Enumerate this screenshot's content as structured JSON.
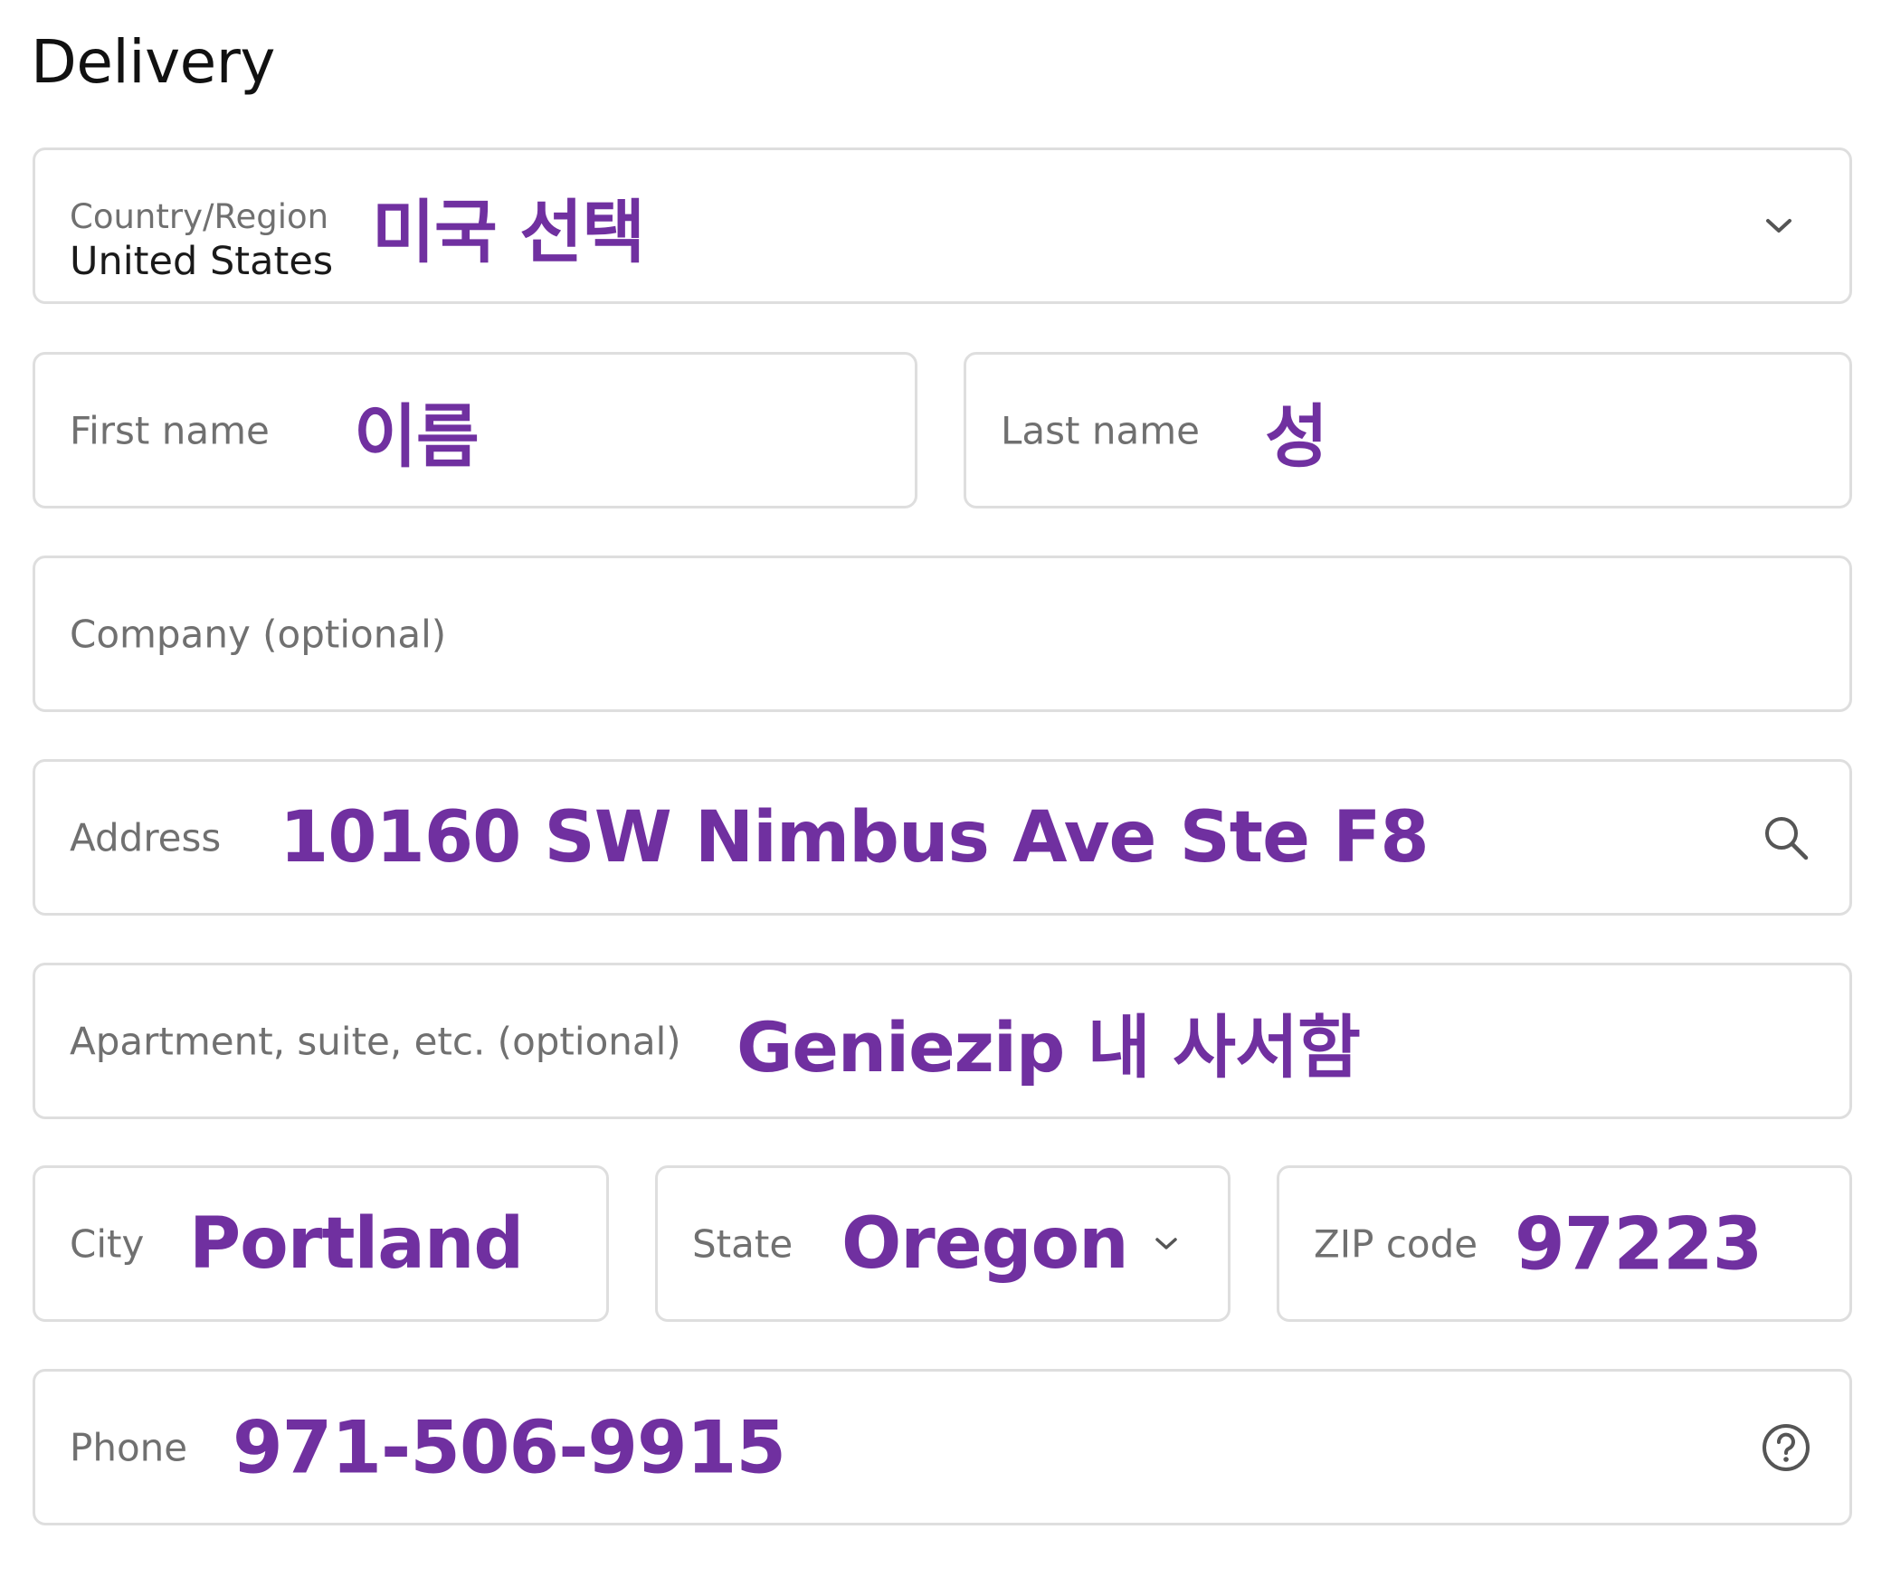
{
  "section": {
    "title": "Delivery"
  },
  "colors": {
    "annotation": "#7030A0",
    "label": "#707070",
    "border": "#DEDEDE"
  },
  "fields": {
    "country": {
      "label": "Country/Region",
      "value": "United States",
      "annotation": "미국 선택",
      "icon": "chevron-down-icon"
    },
    "first_name": {
      "label": "First name",
      "value": "",
      "annotation": "이름"
    },
    "last_name": {
      "label": "Last name",
      "value": "",
      "annotation": "성"
    },
    "company": {
      "label": "Company (optional)",
      "value": ""
    },
    "address": {
      "label": "Address",
      "value": "",
      "annotation": "10160 SW Nimbus Ave Ste F8",
      "icon": "search-icon"
    },
    "apartment": {
      "label": "Apartment, suite, etc. (optional)",
      "value": "",
      "annotation": "Geniezip 내 사서함"
    },
    "city": {
      "label": "City",
      "value": "",
      "annotation": "Portland"
    },
    "state": {
      "label": "State",
      "value": "",
      "annotation": "Oregon",
      "icon": "chevron-down-icon"
    },
    "zip": {
      "label": "ZIP code",
      "value": "",
      "annotation": "97223"
    },
    "phone": {
      "label": "Phone",
      "value": "",
      "annotation": "971-506-9915",
      "icon": "help-circle-icon"
    }
  }
}
